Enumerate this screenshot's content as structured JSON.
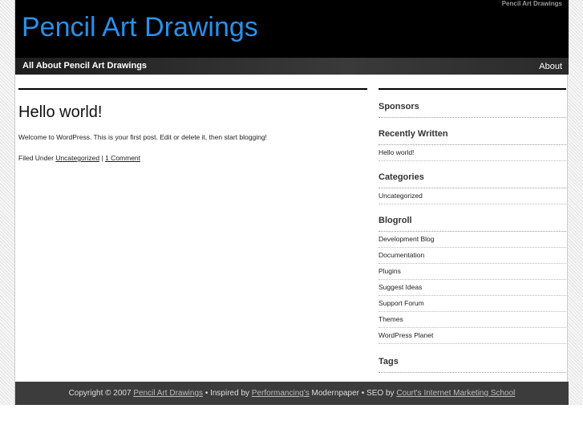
{
  "header": {
    "top_right": "Pencil Art Drawings",
    "site_title": "Pencil Art Drawings"
  },
  "nav": {
    "description": "All About Pencil Art Drawings",
    "about": "About"
  },
  "post": {
    "title": "Hello world!",
    "body": "Welcome to WordPress. This is your first post. Edit or delete it, then start blogging!",
    "filed_under": "Filed Under",
    "category": "Uncategorized",
    "separator": "|",
    "comments": "1 Comment"
  },
  "sidebar": {
    "sponsors": "Sponsors",
    "recent": {
      "title": "Recently Written",
      "items": [
        "Hello world!"
      ]
    },
    "categories": {
      "title": "Categories",
      "items": [
        "Uncategorized"
      ]
    },
    "blogroll": {
      "title": "Blogroll",
      "items": [
        "Development Blog",
        "Documentation",
        "Plugins",
        "Suggest Ideas",
        "Support Forum",
        "Themes",
        "WordPress Planet"
      ]
    },
    "tags": "Tags"
  },
  "footer": {
    "copyright": "Copyright © 2007",
    "site_link": "Pencil Art Drawings",
    "inspired": "• Inspired by",
    "perf_link": "Performancing's",
    "modern": "Modernpaper • SEO by",
    "seo_link": "Court's Internet Marketing School"
  }
}
